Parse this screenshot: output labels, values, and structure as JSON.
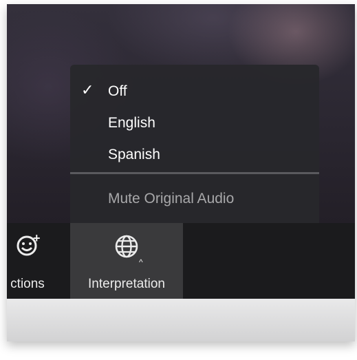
{
  "interpretation_menu": {
    "items": [
      {
        "label": "Off",
        "checked": true
      },
      {
        "label": "English",
        "checked": false
      },
      {
        "label": "Spanish",
        "checked": false
      }
    ],
    "check_mark": "✓",
    "mute_original_audio_label": "Mute Original Audio"
  },
  "toolbar": {
    "reactions_label": "ctions",
    "reactions_plus": "+",
    "interpretation_label": "Interpretation",
    "interpretation_caret": "^"
  },
  "icons": {
    "reactions": "smiley-add-icon",
    "interpretation": "globe-icon",
    "dropdown": "caret-up-icon"
  },
  "colors": {
    "toolbar_bg": "#1b1b1d",
    "active_button_bg": "#3a3a3c",
    "menu_bg": "#28282c",
    "menu_text": "#ffffff",
    "disabled_text": "#a8a8aa"
  }
}
